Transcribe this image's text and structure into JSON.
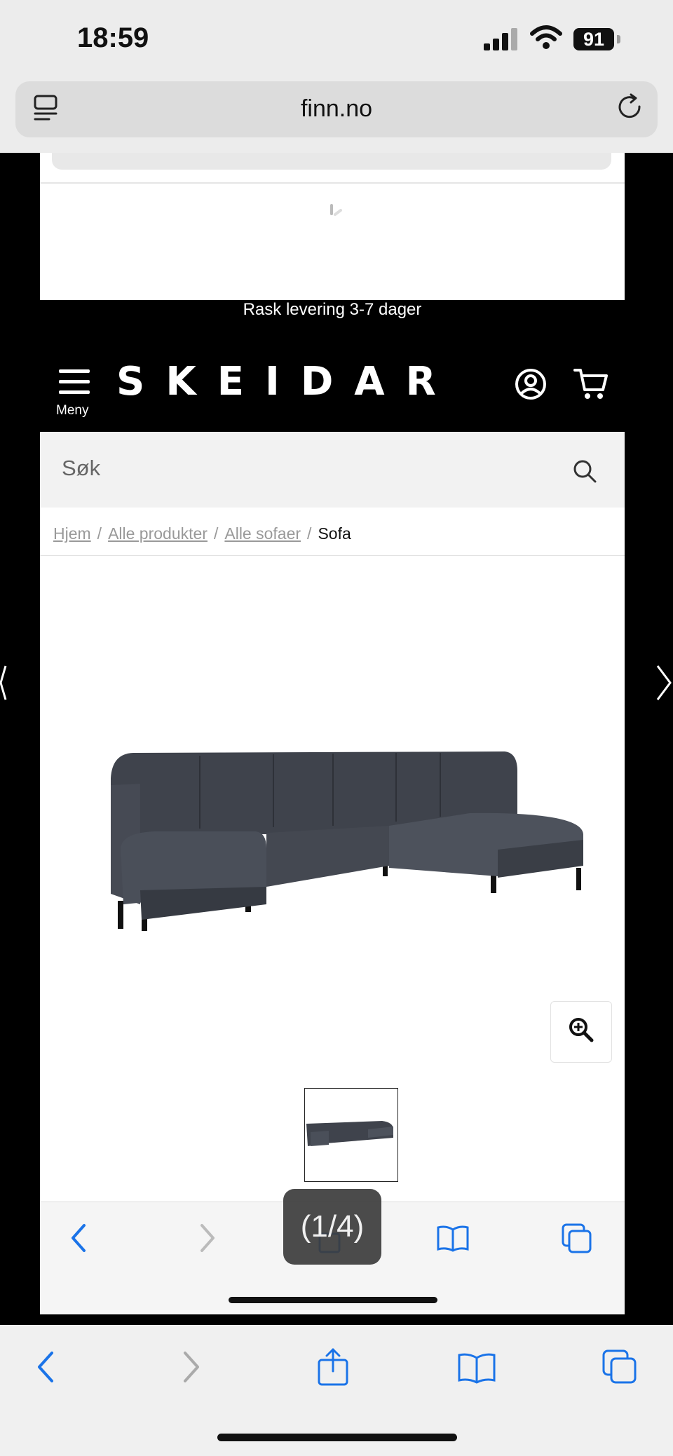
{
  "status": {
    "time": "18:59",
    "battery": "91"
  },
  "browser": {
    "url": "finn.no"
  },
  "site": {
    "promo": "Rask levering 3-7 dager",
    "brand": "SKEIDAR",
    "menu_label": "Meny",
    "search_placeholder": "Søk",
    "breadcrumb": [
      {
        "label": "Hjem"
      },
      {
        "label": "Alle produkter"
      },
      {
        "label": "Alle sofaer"
      },
      {
        "label": "Sofa"
      }
    ]
  },
  "gallery": {
    "counter": "(1/4)"
  },
  "colors": {
    "accent": "#1a73e8",
    "dark": "#000000",
    "light": "#f2f2f2"
  }
}
